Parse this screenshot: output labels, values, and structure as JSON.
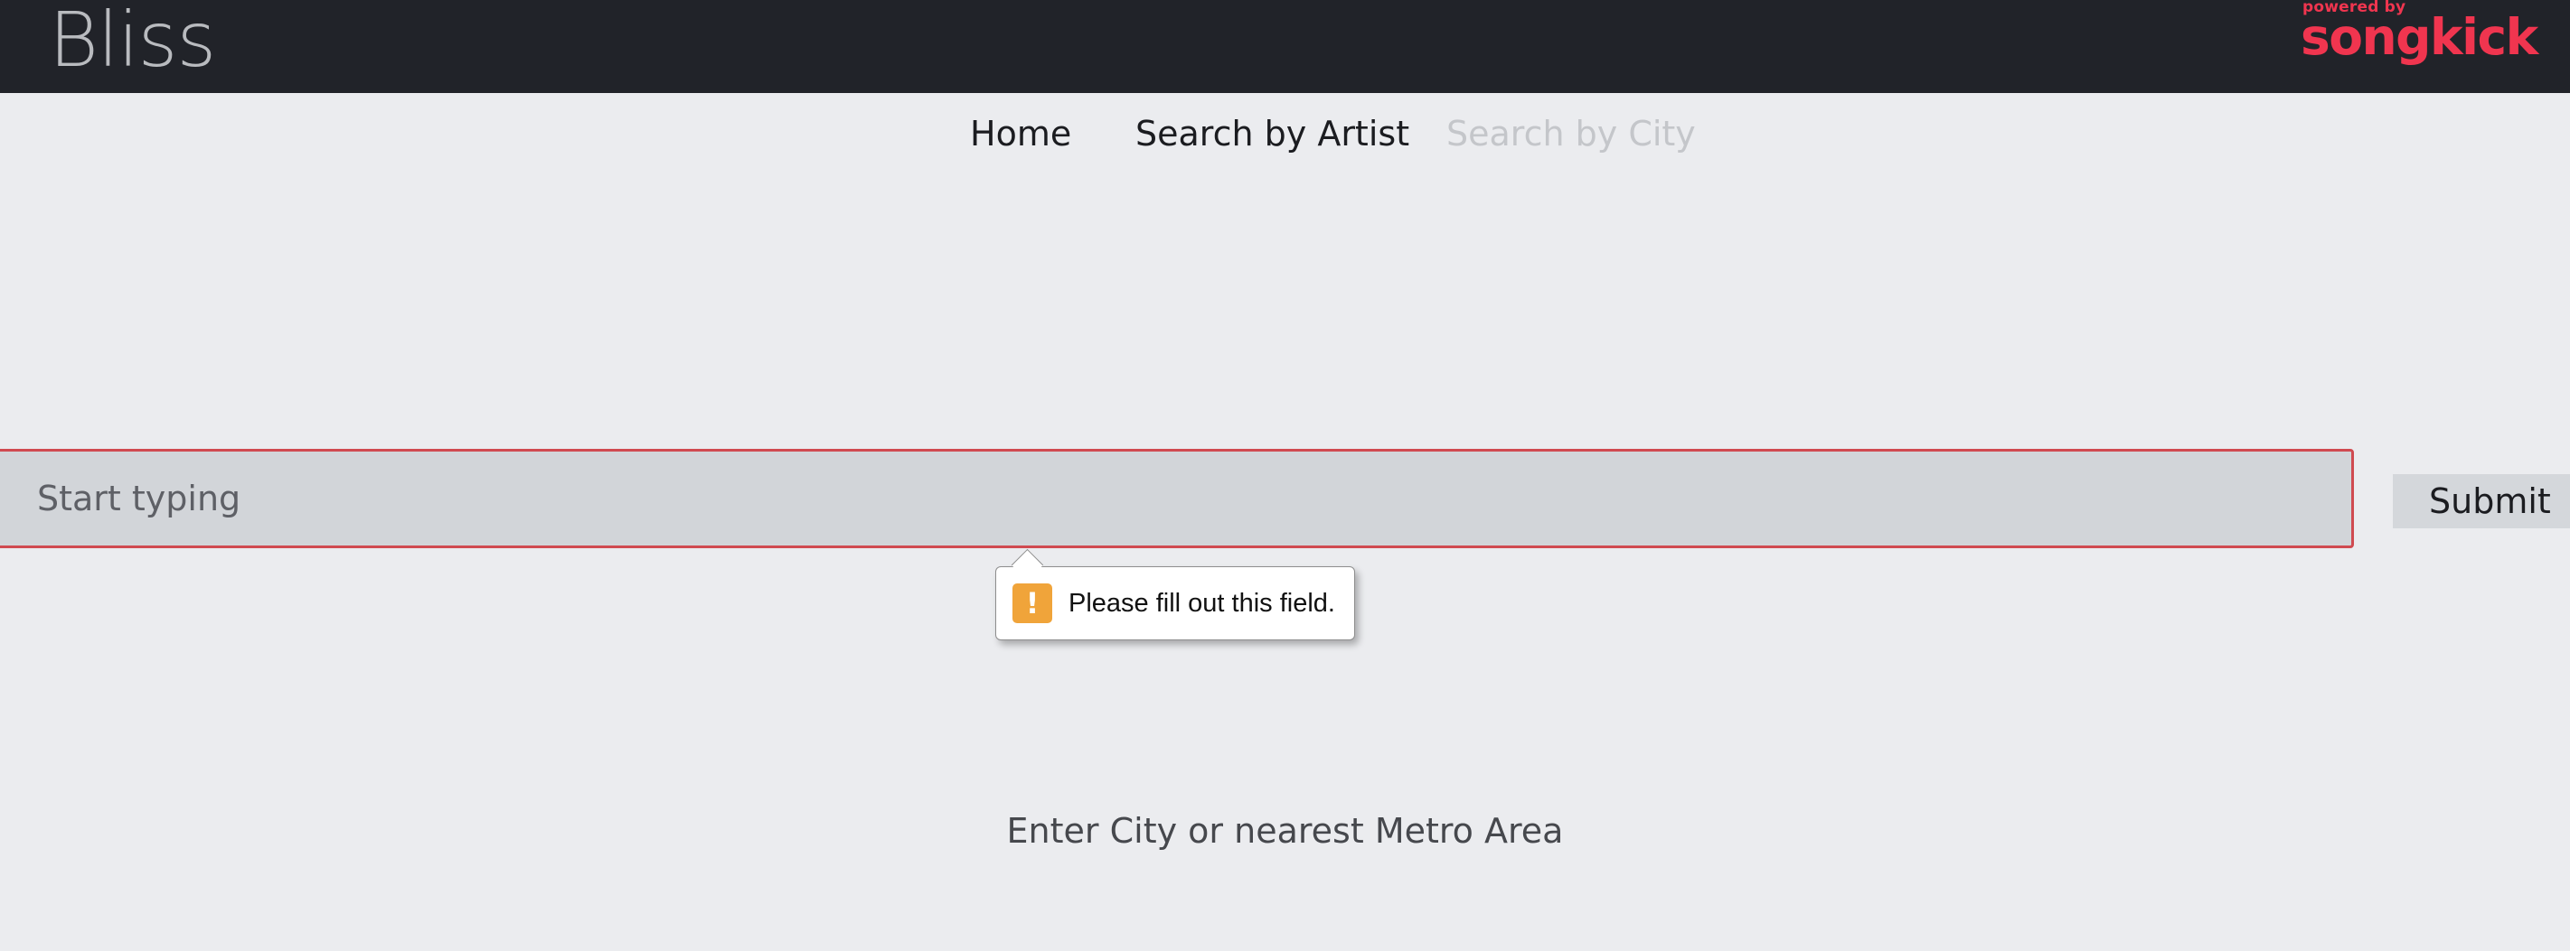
{
  "header": {
    "brand": "Bliss",
    "partner_logo": {
      "powered_by": "powered by",
      "name": "songkick",
      "color": "#f0354f"
    }
  },
  "nav": {
    "items": [
      {
        "label": "Home",
        "state": "default"
      },
      {
        "label": "Search by Artist",
        "state": "default"
      },
      {
        "label": "Search by City",
        "state": "active"
      }
    ]
  },
  "search": {
    "value": "",
    "placeholder": "Start typing",
    "submit_label": "Submit",
    "border_color": "#d04a50"
  },
  "validation_tooltip": {
    "icon": "warning-icon",
    "icon_glyph": "!",
    "message": "Please fill out this field."
  },
  "helper": {
    "text": "Enter City or nearest Metro Area"
  },
  "colors": {
    "topbar": "#212329",
    "background": "#ebecef",
    "warning": "#f0a43a"
  }
}
